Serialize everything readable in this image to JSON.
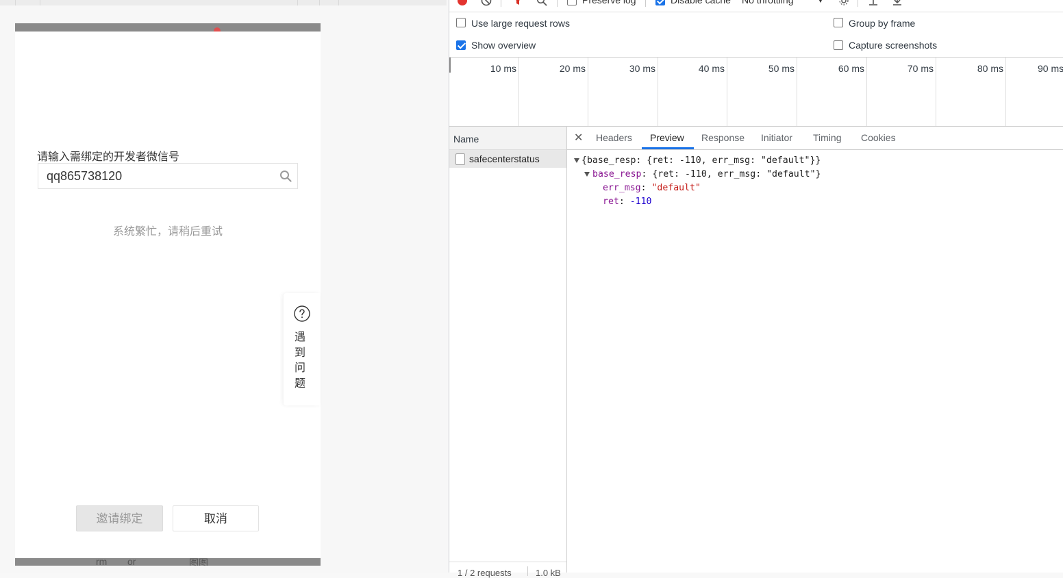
{
  "page": {
    "field_label": "请输入需绑定的开发者微信号",
    "input_value": "qq865738120",
    "error_text": "系统繁忙，请稍后重试",
    "help_text": "遇到问题",
    "invite_button": "邀请绑定",
    "cancel_button": "取消",
    "under_text": [
      "rm",
      "or",
      "图图"
    ]
  },
  "devtools": {
    "toolbar": {
      "preserve_log": "Preserve log",
      "disable_cache": "Disable cache",
      "throttling": "No throttling"
    },
    "options": {
      "large_rows": "Use large request rows",
      "show_overview": "Show overview",
      "group_by_frame": "Group by frame",
      "capture_screenshots": "Capture screenshots"
    },
    "overview_ticks": [
      "10 ms",
      "20 ms",
      "30 ms",
      "40 ms",
      "50 ms",
      "60 ms",
      "70 ms",
      "80 ms",
      "90 ms"
    ],
    "name_header": "Name",
    "request_name": "safecenterstatus",
    "status": {
      "requests": "1 / 2 requests",
      "size": "1.0 kB"
    },
    "tabs": [
      "Headers",
      "Preview",
      "Response",
      "Initiator",
      "Timing",
      "Cookies"
    ],
    "active_tab": "Preview",
    "preview": {
      "root_summary": "{base_resp: {ret: -110, err_msg: \"default\"}}",
      "base_resp_key": "base_resp",
      "base_resp_summary": "{ret: -110, err_msg: \"default\"}",
      "err_msg_key": "err_msg",
      "err_msg_value": "\"default\"",
      "ret_key": "ret",
      "ret_value": "-110"
    }
  }
}
